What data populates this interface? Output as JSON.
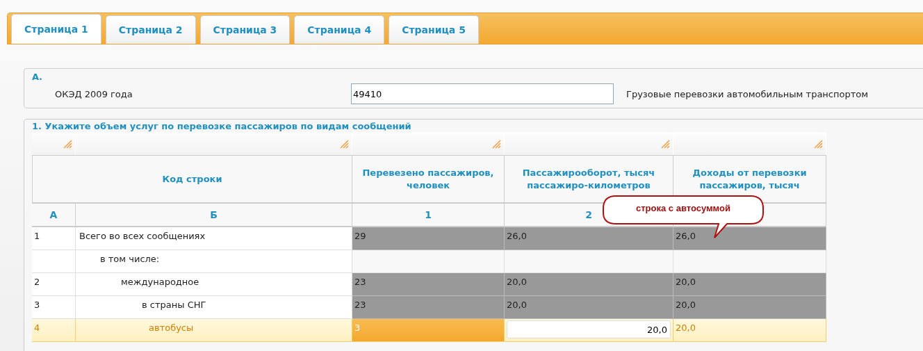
{
  "tabs": [
    {
      "label": "Страница 1",
      "selected": true
    },
    {
      "label": "Страница 2",
      "selected": false
    },
    {
      "label": "Страница 3",
      "selected": false
    },
    {
      "label": "Страница 4",
      "selected": false
    },
    {
      "label": "Страница 5",
      "selected": false
    }
  ],
  "section_a": {
    "title": "А.",
    "label": "ОКЭД 2009 года",
    "value": "49410",
    "description": "Грузовые перевозки автомобильным транспортом"
  },
  "section_1": {
    "title": "1. Укажите объем услуг по перевозке пассажиров по видам сообщений",
    "columns": [
      {
        "heading": "Код строки",
        "code": "А"
      },
      {
        "code": "Б"
      },
      {
        "heading": "Перевезено пассажиров, человек",
        "code": "1"
      },
      {
        "heading": "Пассажирооборот, тысяч пассажиро-километров",
        "code": "2"
      },
      {
        "heading": "Доходы от перевозки пассажиров, тысяч"
      }
    ],
    "rows": [
      {
        "code": "1",
        "name": "Всего во всех сообщениях",
        "selected": false,
        "cells": [
          {
            "kind": "auto",
            "value": "29"
          },
          {
            "kind": "auto",
            "value": "26,0"
          },
          {
            "kind": "auto",
            "value": "26,0"
          }
        ],
        "children": [
          {
            "name": "в том числе:",
            "selected": false,
            "cells": [
              {
                "kind": "blank"
              },
              {
                "kind": "blank"
              },
              {
                "kind": "blank"
              }
            ],
            "children": [
              {
                "code": "2",
                "name": "международное",
                "selected": false,
                "cells": [
                  {
                    "kind": "auto",
                    "value": "23"
                  },
                  {
                    "kind": "auto",
                    "value": "20,0"
                  },
                  {
                    "kind": "auto",
                    "value": "20,0"
                  }
                ],
                "children": [
                  {
                    "code": "3",
                    "name": "в страны СНГ",
                    "selected": false,
                    "cells": [
                      {
                        "kind": "auto",
                        "value": "23"
                      },
                      {
                        "kind": "auto",
                        "value": "20,0"
                      },
                      {
                        "kind": "auto",
                        "value": "20,0"
                      }
                    ],
                    "children": [
                      {
                        "code": "4",
                        "name": "автобусы",
                        "selected": true,
                        "cells": [
                          {
                            "kind": "active",
                            "value": "3"
                          },
                          {
                            "kind": "input",
                            "value": "20,0"
                          },
                          {
                            "kind": "auto",
                            "value": "20,0"
                          }
                        ]
                      }
                    ]
                  }
                ]
              }
            ]
          }
        ]
      }
    ]
  },
  "callout": {
    "text": "строка с автосуммой"
  }
}
